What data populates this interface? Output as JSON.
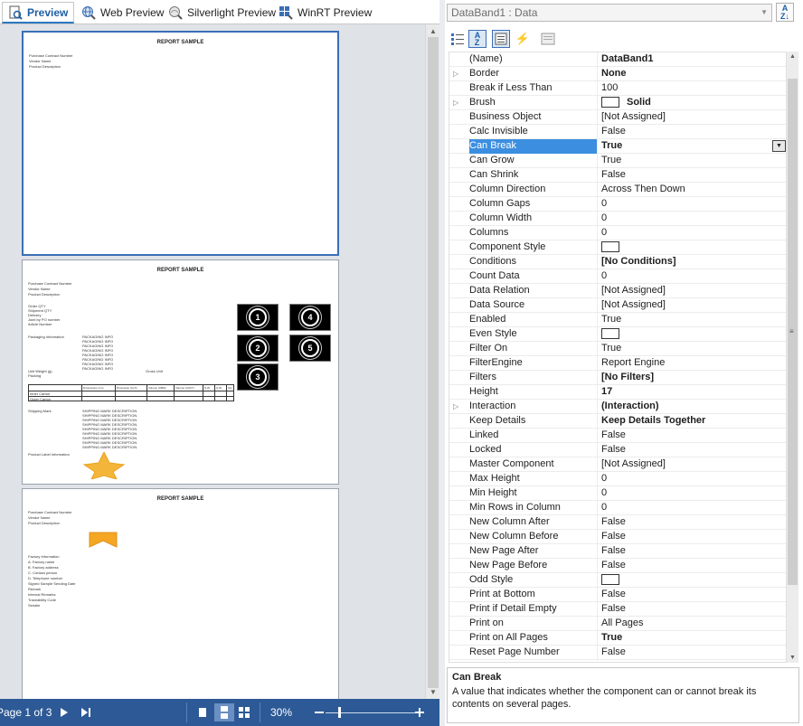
{
  "tabs": [
    {
      "label": "Preview",
      "icon": "preview-icon",
      "active": true
    },
    {
      "label": "Web Preview",
      "icon": "web-preview-icon",
      "active": false
    },
    {
      "label": "Silverlight Preview",
      "icon": "silverlight-preview-icon",
      "active": false
    },
    {
      "label": "WinRT Preview",
      "icon": "winrt-preview-icon",
      "active": false
    }
  ],
  "pages": [
    {
      "title": "REPORT SAMPLE",
      "lines": [
        "Purchase Contract Number",
        "Vendor Name",
        "Product Description"
      ]
    },
    {
      "title": "REPORT SAMPLE",
      "header_lines": [
        "Purchase Contract Number",
        "Vendor Name",
        "Product Description"
      ],
      "order_lines": [
        "Order QTY",
        "Shipment QTY",
        "Delivery",
        "Joint by PO number",
        "Article Number"
      ],
      "packaging_label": "Packaging Information",
      "packaging_lines": [
        "PACKAGING INFO",
        "PACKAGING INFO",
        "PACKAGING INFO",
        "PACKAGING INFO",
        "PACKAGING INFO",
        "PACKAGING INFO",
        "PACKAGING INFO",
        "PACKAGING INFO"
      ],
      "unit_weight": "Unit Weight (g)",
      "gross_unit": "Gross Unit",
      "packing": "Packing",
      "table_headers": [
        "Dimensions (cm)",
        "Dimension (inch)",
        "Volume (CBM)",
        "Volume (CUFT)",
        "N.W.",
        "G.W.",
        "Qty"
      ],
      "table_rows": [
        "Inner Carton",
        "Outer Carton"
      ],
      "shipping_label": "Shipping Mark",
      "shipping_lines": [
        "SHIPPING MARK DESCRIPTION",
        "SHIPPING MARK DESCRIPTION",
        "SHIPPING MARK DESCRIPTION",
        "SHIPPING MARK DESCRIPTION",
        "SHIPPING MARK DESCRIPTION",
        "SHIPPING MARK DESCRIPTION",
        "SHIPPING MARK DESCRIPTION",
        "SHIPPING MARK DESCRIPTION",
        "SHIPPING MARK DESCRIPTION"
      ],
      "product_label": "Product Label Information",
      "badges": [
        "1",
        "4",
        "2",
        "5",
        "3"
      ]
    },
    {
      "title": "REPORT SAMPLE",
      "header_lines": [
        "Purchase Contract Number",
        "Vendor Name",
        "Product Description"
      ],
      "factory_lines": [
        "Factory Information",
        "A.   Factory name",
        "B.   Factory address",
        "C.   Contact person",
        "D.   Telephone number",
        "Signed Sample Sending Date",
        "Remark",
        "Internal Remarks",
        "Traceability Code",
        "Seriaile"
      ]
    }
  ],
  "statusbar": {
    "page_label": "Page 1 of 3",
    "zoom": "30%",
    "zoom_level": 0.14
  },
  "component_selector": "DataBand1 : Data",
  "properties": [
    {
      "name": "(Name)",
      "value": "DataBand1",
      "bold": true
    },
    {
      "name": "Border",
      "value": "None",
      "bold": true,
      "expandable": true
    },
    {
      "name": "Break if Less Than",
      "value": "100"
    },
    {
      "name": "Brush",
      "value": "Solid",
      "bold": true,
      "expandable": true,
      "swatch": true
    },
    {
      "name": "Business Object",
      "value": "[Not Assigned]"
    },
    {
      "name": "Calc Invisible",
      "value": "False"
    },
    {
      "name": "Can Break",
      "value": "True",
      "bold": true,
      "selected": true
    },
    {
      "name": "Can Grow",
      "value": "True"
    },
    {
      "name": "Can Shrink",
      "value": "False"
    },
    {
      "name": "Column Direction",
      "value": "Across Then Down"
    },
    {
      "name": "Column Gaps",
      "value": "0"
    },
    {
      "name": "Column Width",
      "value": "0"
    },
    {
      "name": "Columns",
      "value": "0"
    },
    {
      "name": "Component Style",
      "value": "",
      "swatch": true
    },
    {
      "name": "Conditions",
      "value": "[No Conditions]",
      "bold": true
    },
    {
      "name": "Count Data",
      "value": "0"
    },
    {
      "name": "Data Relation",
      "value": "[Not Assigned]"
    },
    {
      "name": "Data Source",
      "value": "[Not Assigned]"
    },
    {
      "name": "Enabled",
      "value": "True"
    },
    {
      "name": "Even Style",
      "value": "",
      "swatch": true
    },
    {
      "name": "Filter On",
      "value": "True"
    },
    {
      "name": "FilterEngine",
      "value": "Report Engine"
    },
    {
      "name": "Filters",
      "value": "[No Filters]",
      "bold": true
    },
    {
      "name": "Height",
      "value": "17",
      "bold": true
    },
    {
      "name": "Interaction",
      "value": "(Interaction)",
      "bold": true,
      "expandable": true
    },
    {
      "name": "Keep Details",
      "value": "Keep Details Together",
      "bold": true
    },
    {
      "name": "Linked",
      "value": "False"
    },
    {
      "name": "Locked",
      "value": "False"
    },
    {
      "name": "Master Component",
      "value": "[Not Assigned]"
    },
    {
      "name": "Max Height",
      "value": "0"
    },
    {
      "name": "Min Height",
      "value": "0"
    },
    {
      "name": "Min Rows in Column",
      "value": "0"
    },
    {
      "name": "New Column After",
      "value": "False"
    },
    {
      "name": "New Column Before",
      "value": "False"
    },
    {
      "name": "New Page After",
      "value": "False"
    },
    {
      "name": "New Page Before",
      "value": "False"
    },
    {
      "name": "Odd Style",
      "value": "",
      "swatch": true
    },
    {
      "name": "Print at Bottom",
      "value": "False"
    },
    {
      "name": "Print if Detail Empty",
      "value": "False"
    },
    {
      "name": "Print on",
      "value": "All Pages"
    },
    {
      "name": "Print on All Pages",
      "value": "True",
      "bold": true
    },
    {
      "name": "Reset Page Number",
      "value": "False"
    }
  ],
  "description": {
    "title": "Can Break",
    "text": "A value that indicates whether the component can or cannot break its contents on several pages."
  },
  "colors": {
    "accent": "#2d5a96",
    "selection": "#3c8ee0",
    "tab_active": "#1d5fa5"
  }
}
